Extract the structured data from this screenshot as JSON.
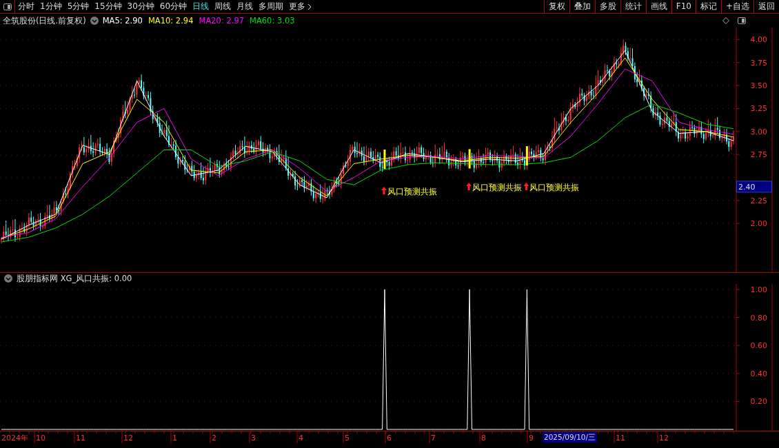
{
  "toolbar": {
    "periods": [
      {
        "label": "分时",
        "selected": false
      },
      {
        "label": "1分钟",
        "selected": false
      },
      {
        "label": "5分钟",
        "selected": false
      },
      {
        "label": "15分钟",
        "selected": false
      },
      {
        "label": "30分钟",
        "selected": false
      },
      {
        "label": "60分钟",
        "selected": false
      },
      {
        "label": "日线",
        "selected": true
      },
      {
        "label": "周线",
        "selected": false
      },
      {
        "label": "月线",
        "selected": false
      },
      {
        "label": "多周期",
        "selected": false
      },
      {
        "label": "更多",
        "selected": false
      }
    ],
    "actions": [
      "复权",
      "叠加",
      "多股",
      "统计",
      "画线",
      "F10",
      "标记",
      "+自选",
      "返回"
    ]
  },
  "info": {
    "stock_label": "全筑股份(日线.前复权)",
    "averages": [
      ": 2.90",
      ": 2.94",
      ": 2.97",
      ": 3.03"
    ]
  },
  "price_chart": {
    "cursor_price": "2.40",
    "chart_data": {
      "type": "line",
      "grid": true,
      "ylim": [
        1.47,
        4.13
      ],
      "yticks": [
        {
          "value": 4,
          "label": "4.00"
        },
        {
          "value": 3.75,
          "label": "3.75"
        },
        {
          "value": 3.5,
          "label": "3.50"
        },
        {
          "value": 3.25,
          "label": "3.25"
        },
        {
          "value": 3,
          "label": "3.00"
        },
        {
          "value": 2.75,
          "label": "2.75"
        },
        {
          "value": 2.25,
          "label": "2.25"
        },
        {
          "value": 2,
          "label": "2.00"
        }
      ],
      "series": [
        {
          "name": "MA5",
          "color": "#ffffff",
          "values": [
            1.83,
            1.98,
            2.1,
            2.85,
            2.75,
            3.55,
            2.95,
            2.52,
            2.58,
            2.84,
            2.78,
            2.42,
            2.28,
            2.8,
            2.66,
            2.76,
            2.72,
            2.67,
            2.7,
            2.68,
            2.76,
            3.25,
            3.5,
            3.88,
            3.22,
            2.98,
            3.0,
            2.9
          ]
        },
        {
          "name": "MA10",
          "color": "#ffff00",
          "values": [
            1.84,
            1.94,
            2.08,
            2.65,
            2.78,
            3.35,
            3.1,
            2.58,
            2.55,
            2.78,
            2.8,
            2.5,
            2.3,
            2.65,
            2.7,
            2.74,
            2.72,
            2.68,
            2.72,
            2.71,
            2.73,
            3.1,
            3.42,
            3.8,
            3.35,
            3.02,
            3.0,
            2.94
          ]
        },
        {
          "name": "MA20",
          "color": "#ff00ff",
          "values": [
            1.85,
            1.9,
            2.05,
            2.4,
            2.72,
            3.1,
            3.25,
            2.7,
            2.52,
            2.7,
            2.8,
            2.6,
            2.35,
            2.5,
            2.68,
            2.72,
            2.73,
            2.7,
            2.74,
            2.73,
            2.71,
            2.95,
            3.3,
            3.68,
            3.55,
            3.1,
            3.02,
            2.97
          ]
        },
        {
          "name": "MA60",
          "color": "#00e000",
          "values": [
            1.8,
            1.85,
            1.95,
            2.1,
            2.3,
            2.55,
            2.8,
            2.8,
            2.62,
            2.68,
            2.78,
            2.68,
            2.48,
            2.42,
            2.58,
            2.64,
            2.66,
            2.65,
            2.64,
            2.64,
            2.66,
            2.72,
            2.9,
            3.15,
            3.3,
            3.2,
            3.08,
            3.03
          ]
        }
      ]
    }
  },
  "signals": [
    {
      "label": "风口预测共振"
    },
    {
      "label": "风口预测共振"
    },
    {
      "label": "风口预测共振"
    }
  ],
  "indicator": {
    "source": "股朋指标网",
    "value": ": 0.00",
    "chart_data": {
      "type": "line",
      "grid": true,
      "ylim": [
        0,
        1.039
      ],
      "yticks": [
        {
          "value": 1,
          "label": "1.00"
        },
        {
          "value": 0.8,
          "label": "0.80"
        },
        {
          "value": 0.6,
          "label": "0.60"
        },
        {
          "value": 0.4,
          "label": "0.40"
        },
        {
          "value": 0.2,
          "label": "0.20"
        }
      ],
      "categories": [
        null,
        null,
        null,
        null,
        null,
        null,
        null,
        null,
        null,
        null,
        null,
        null,
        null,
        null,
        null,
        null,
        null,
        null,
        null,
        null,
        null,
        null,
        null,
        null,
        null,
        null,
        null,
        null,
        null,
        null,
        null,
        null,
        null,
        null,
        null,
        null,
        null,
        null,
        null,
        null,
        null,
        null,
        null,
        null,
        null,
        null,
        null,
        null,
        null,
        null,
        null,
        null,
        null,
        null,
        null,
        null,
        null,
        null,
        null,
        null,
        null,
        null,
        null,
        null,
        null,
        null,
        null,
        null,
        null,
        null,
        null,
        null,
        null,
        null,
        null,
        null,
        null,
        null,
        null,
        null,
        null,
        null,
        null,
        null,
        null,
        null,
        null,
        null,
        null,
        null,
        null,
        null,
        null,
        null,
        null,
        null,
        null,
        null,
        null,
        null,
        null,
        null,
        null,
        null,
        null,
        null,
        null,
        null,
        null,
        null,
        null,
        null,
        null,
        null,
        null,
        null,
        null,
        null,
        null,
        null,
        null,
        null,
        null,
        null,
        null,
        null,
        null,
        null,
        null,
        null,
        null,
        null,
        null,
        null,
        null,
        null,
        null,
        null,
        null,
        null,
        null,
        null,
        null,
        null,
        null,
        null,
        null,
        null,
        null,
        null,
        null,
        null,
        null,
        null,
        null,
        null,
        null,
        null,
        null,
        null,
        null,
        null,
        null,
        null,
        null,
        null,
        null,
        null,
        null,
        null,
        null,
        null,
        null,
        null,
        null,
        null,
        null,
        null,
        null,
        null,
        null,
        null,
        null,
        null,
        null,
        null,
        null,
        null,
        null,
        null,
        null,
        null,
        null,
        null,
        null,
        null,
        null,
        null,
        null,
        null,
        null,
        null,
        null,
        null,
        null,
        null,
        null,
        null,
        null,
        null,
        null,
        null,
        null,
        null,
        null,
        null,
        null,
        null,
        null,
        null,
        null,
        null,
        null,
        null,
        null,
        null,
        null,
        null,
        null,
        null,
        null,
        null,
        null,
        null,
        null,
        null,
        null,
        null,
        null,
        null,
        null,
        null,
        null,
        null,
        null,
        null,
        null,
        null,
        null,
        null,
        null,
        null,
        null,
        null,
        null,
        null,
        null,
        null,
        null,
        null,
        null,
        null,
        null,
        null,
        null,
        null,
        null,
        null,
        null,
        null,
        null,
        null,
        null,
        null,
        null,
        null,
        null,
        null,
        null,
        null,
        null,
        null,
        null,
        null,
        null,
        null,
        null,
        null,
        null,
        null,
        null,
        null,
        null,
        null,
        null,
        null,
        null,
        null,
        null,
        null,
        null,
        null,
        null,
        null,
        null,
        null,
        null,
        null,
        null,
        null,
        null,
        null,
        null,
        null,
        null,
        null,
        null,
        null,
        null,
        null
      ],
      "series": [
        {
          "name": "XG_风口共振",
          "color": "#ffffff",
          "values": [
            0,
            0,
            0,
            0,
            0,
            0,
            0,
            0,
            0,
            0,
            0,
            0,
            0,
            0,
            0,
            0,
            0,
            0,
            0,
            0,
            0,
            0,
            0,
            0,
            0,
            0,
            0,
            0,
            0,
            0,
            0,
            0,
            0,
            0,
            0,
            0,
            0,
            0,
            0,
            0,
            0,
            0,
            0,
            0,
            0,
            0,
            0,
            0,
            0,
            0,
            0,
            0,
            0,
            0,
            0,
            0,
            0,
            0,
            0,
            0,
            0,
            0,
            0,
            0,
            0,
            0,
            0,
            0,
            0,
            0,
            0,
            0,
            0,
            0,
            0,
            0,
            0,
            0,
            0,
            0,
            0,
            0,
            0,
            0,
            0,
            0,
            0,
            0,
            0,
            0,
            0,
            0,
            0,
            0,
            0,
            0,
            0,
            0,
            0,
            0,
            0,
            0,
            0,
            0,
            0,
            0,
            0,
            0,
            0,
            0,
            0,
            0,
            0,
            0,
            0,
            0,
            0,
            0,
            0,
            0,
            0,
            0,
            0,
            0,
            0,
            0,
            0,
            0,
            0,
            0,
            0,
            0,
            0,
            0,
            0,
            0,
            0,
            0,
            0,
            0,
            0,
            0,
            0,
            0,
            0,
            0,
            0,
            0,
            0,
            0,
            0,
            0,
            0,
            0,
            0,
            0,
            0,
            0,
            0,
            0,
            0,
            0,
            0,
            0,
            0,
            0,
            0,
            1,
            0,
            0,
            0,
            0,
            0,
            0,
            0,
            0,
            0,
            0,
            0,
            0,
            0,
            0,
            0,
            0,
            0,
            0,
            0,
            0,
            0,
            0,
            0,
            0,
            0,
            0,
            0,
            0,
            0,
            0,
            0,
            0,
            0,
            0,
            0,
            0,
            1,
            0,
            0,
            0,
            0,
            0,
            0,
            0,
            0,
            0,
            0,
            0,
            0,
            0,
            0,
            0,
            0,
            0,
            0,
            0,
            0,
            0,
            0,
            0,
            0,
            1,
            0,
            0,
            0,
            0,
            0,
            0,
            0,
            0,
            0,
            0,
            0,
            0,
            0,
            0,
            0,
            0,
            0,
            0,
            0,
            0,
            0,
            0,
            0,
            0,
            0,
            0,
            0,
            0,
            0,
            0,
            0,
            0,
            0,
            0,
            0,
            0,
            0,
            0,
            0,
            0,
            0,
            0,
            0,
            0,
            0,
            0,
            0,
            0,
            0,
            0,
            0,
            0,
            0,
            0,
            0,
            0,
            0,
            0,
            0,
            0,
            0,
            0,
            0,
            0,
            0,
            0,
            0,
            0,
            0,
            0,
            0,
            0,
            0,
            0,
            0,
            0,
            0,
            0,
            0,
            0,
            0,
            0,
            0,
            0,
            0,
            0,
            0,
            0,
            0,
            0
          ]
        }
      ]
    }
  },
  "date_axis": {
    "year": "2024年",
    "months": [
      "10",
      "11",
      "12",
      "1",
      "2",
      "3",
      "4",
      "5",
      "6",
      "7",
      "8",
      "9",
      "11",
      "12"
    ],
    "cursor_date": "2025/09/10/三"
  }
}
